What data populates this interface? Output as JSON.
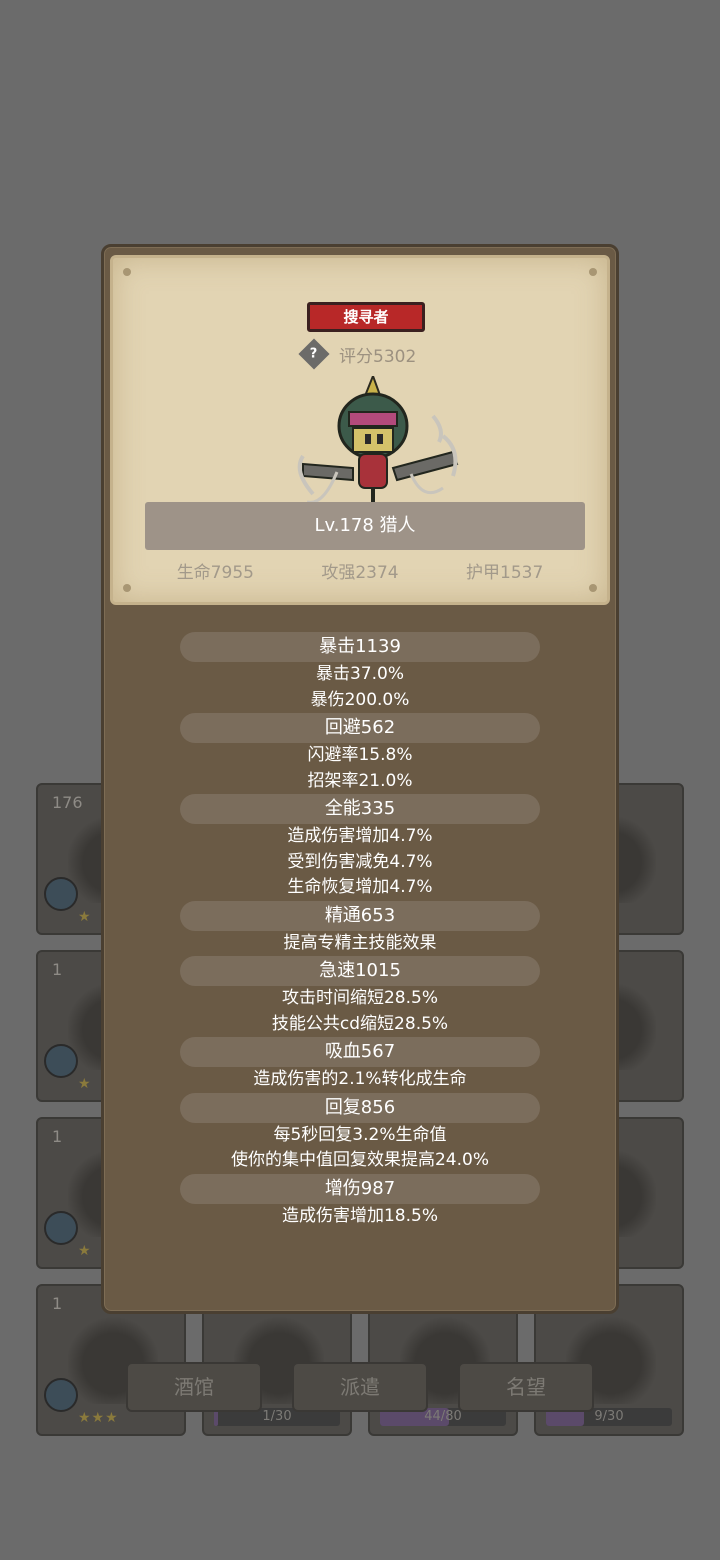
{
  "hero": {
    "role_badge": "搜寻者",
    "score": "评分5302",
    "name_level": "Lv.178 猎人",
    "hp": "生命7955",
    "attack": "攻强2374",
    "armor": "护甲1537"
  },
  "stats": [
    {
      "header": "暴击1139",
      "lines": [
        "暴击37.0%",
        "暴伤200.0%"
      ]
    },
    {
      "header": "回避562",
      "lines": [
        "闪避率15.8%",
        "招架率21.0%"
      ]
    },
    {
      "header": "全能335",
      "lines": [
        "造成伤害增加4.7%",
        "受到伤害减免4.7%",
        "生命恢复增加4.7%"
      ]
    },
    {
      "header": "精通653",
      "lines": [
        "提高专精主技能效果"
      ]
    },
    {
      "header": "急速1015",
      "lines": [
        "攻击时间缩短28.5%",
        "技能公共cd缩短28.5%"
      ]
    },
    {
      "header": "吸血567",
      "lines": [
        "造成伤害的2.1%转化成生命"
      ]
    },
    {
      "header": "回复856",
      "lines": [
        "每5秒回复3.2%生命值",
        "使你的集中值回复效果提高24.0%"
      ]
    },
    {
      "header": "增伤987",
      "lines": [
        "造成伤害增加18.5%"
      ]
    }
  ],
  "background": {
    "card_counts": [
      "176",
      "1",
      "1",
      "1"
    ],
    "bottom_progress": [
      {
        "text": "1/30",
        "fraction": 0.033
      },
      {
        "text": "44/80",
        "fraction": 0.55
      },
      {
        "text": "9/30",
        "fraction": 0.3
      }
    ],
    "tabs": [
      "酒馆",
      "派遣",
      "名望"
    ]
  },
  "colors": {
    "overlay_bg": "#6b6b6b",
    "modal_bg": "#6a5a45",
    "parchment": "#e2d4b3",
    "badge_red": "#b82828",
    "stat_pill": "#7b6d5c"
  }
}
